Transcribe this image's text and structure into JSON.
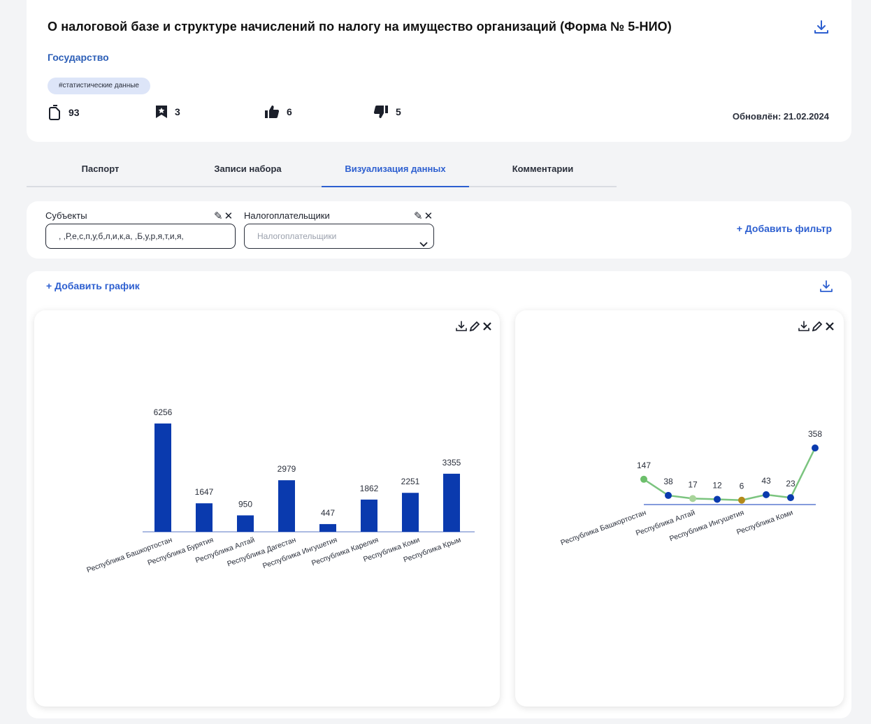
{
  "header": {
    "title": "О налоговой базе и структуре начислений по налогу на имущество организаций (Форма № 5-НИО)",
    "category": "Государство",
    "tag": "#статистические данные",
    "stats": {
      "files": "93",
      "bookmarks": "3",
      "likes": "6",
      "dislikes": "5"
    },
    "updated": "Обновлён: 21.02.2024"
  },
  "tabs": [
    {
      "label": "Паспорт"
    },
    {
      "label": "Записи набора"
    },
    {
      "label": "Визуализация данных"
    },
    {
      "label": "Комментарии"
    }
  ],
  "active_tab": "Визуализация данных",
  "filters": {
    "subjects": {
      "label": "Субъекты",
      "value": " , ,Р,е,с,п,у,б,л,и,к,а, ,Б,у,р,я,т,и,я,"
    },
    "taxpayers": {
      "label": "Налогоплательщики",
      "placeholder": "Налогоплательщики"
    },
    "add_filter": "+ Добавить фильтр"
  },
  "charts_section": {
    "add_chart": "+ Добавить график"
  },
  "colors": {
    "accent": "#2d5fd0",
    "bar": "#0a3aae",
    "line": "#7bc47f",
    "point_blue": "#0a3aae",
    "point_green": "#6cbf6b",
    "point_orange": "#b48a1a"
  },
  "chart_data": [
    {
      "type": "bar",
      "categories": [
        "Республика Башкортостан",
        "Республика Бурятия",
        "Республика Алтай",
        "Республика Дагестан",
        "Республика Ингушетия",
        "Республика Карелия",
        "Республика Коми",
        "Республика Крым"
      ],
      "values": [
        6256,
        1647,
        950,
        2979,
        447,
        1862,
        2251,
        3355
      ],
      "ylim": [
        0,
        6256
      ]
    },
    {
      "type": "line",
      "categories": [
        "Республика Башкортостан",
        "Республика Алтай",
        "Республика Ингушетия",
        "Республика Коми"
      ],
      "values": [
        147,
        38,
        17,
        12,
        6,
        43,
        23,
        358
      ],
      "point_colors": [
        "#6cbf6b",
        "#0a3aae",
        "#a8d49a",
        "#0a3aae",
        "#b48a1a",
        "#0a3aae",
        "#0a3aae",
        "#0a3aae"
      ]
    }
  ]
}
